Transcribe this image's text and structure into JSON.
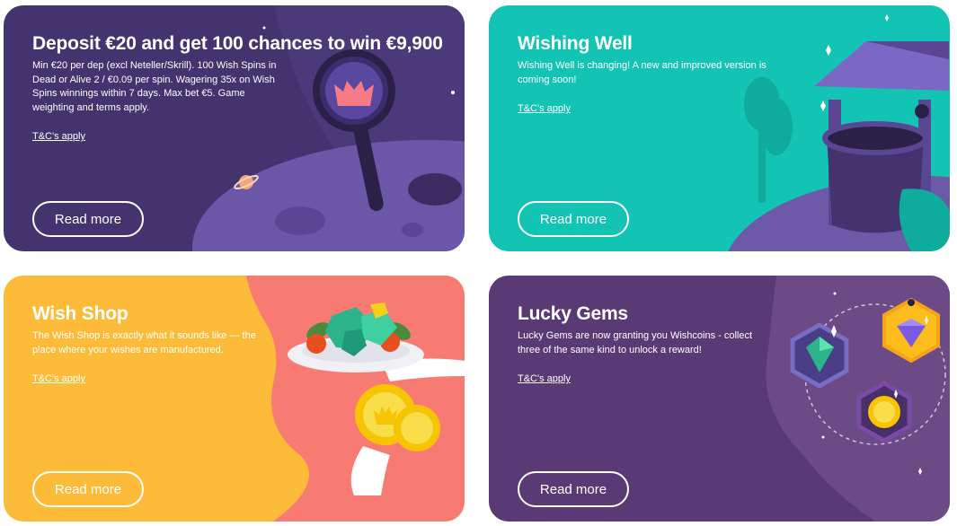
{
  "cards": [
    {
      "title": "Deposit €20 and get 100 chances to win €9,900",
      "description": "Min €20 per dep (excl Neteller/Skrill). 100 Wish Spins in Dead or Alive 2 / €0.09 per spin. Wagering 35x on Wish Spins winnings within 7 days. Max bet €5. Game weighting and terms apply.",
      "tc_label": "T&C's apply",
      "button_label": "Read more",
      "background": "#43336e",
      "illustration": "magnifier-planet-icon"
    },
    {
      "title": "Wishing Well",
      "description": "Wishing Well is changing! A new and improved version is coming soon!",
      "tc_label": "T&C's apply",
      "button_label": "Read more",
      "background": "#13c3b3",
      "illustration": "wishing-well-icon"
    },
    {
      "title": "Wish Shop",
      "description": "The Wish Shop is exactly what it sounds like — the place where your wishes are manufactured.",
      "tc_label": "T&C's apply",
      "button_label": "Read more",
      "background": "#fdbb3a",
      "illustration": "gem-plate-coins-icon"
    },
    {
      "title": "Lucky Gems",
      "description": "Lucky Gems are now granting you Wishcoins - collect three of the same kind to unlock a reward!",
      "tc_label": "T&C's apply",
      "button_label": "Read more",
      "background": "#5a3a74",
      "illustration": "hexagon-gems-icon"
    }
  ]
}
